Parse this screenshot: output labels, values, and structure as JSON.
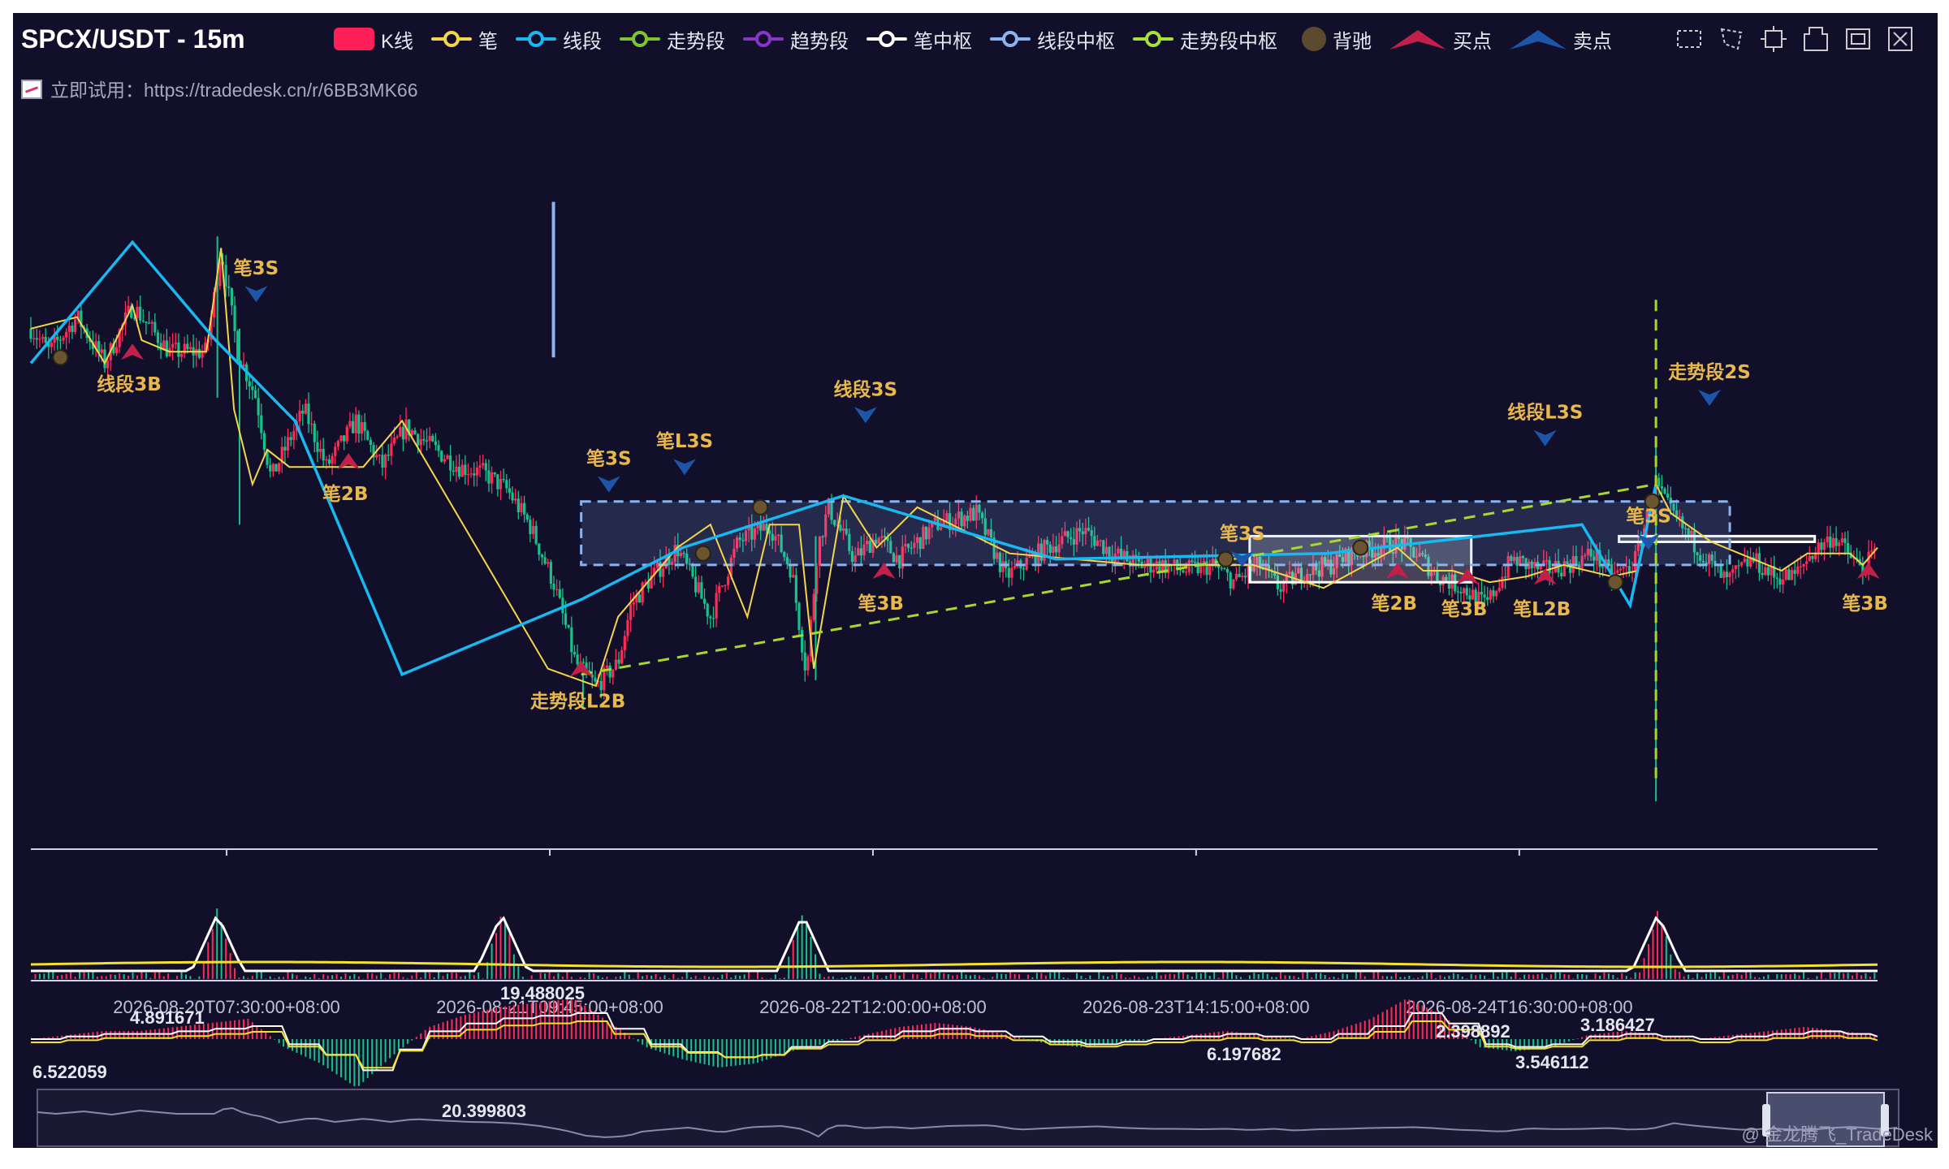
{
  "chart_header": {
    "title": "SPCX/USDT - 15m",
    "trial_text": "立即试用：https://tradedesk.cn/r/6BB3MK66"
  },
  "legend": [
    {
      "label": "K线",
      "color": "#ff1f58",
      "kind": "rect"
    },
    {
      "label": "笔",
      "color": "#f3d64a",
      "kind": "line"
    },
    {
      "label": "线段",
      "color": "#18b8f2",
      "kind": "line"
    },
    {
      "label": "走势段",
      "color": "#7cc72c",
      "kind": "line"
    },
    {
      "label": "趋势段",
      "color": "#8a34cc",
      "kind": "line"
    },
    {
      "label": "笔中枢",
      "color": "#ffffff",
      "kind": "line"
    },
    {
      "label": "线段中枢",
      "color": "#8ab4f0",
      "kind": "line"
    },
    {
      "label": "走势段中枢",
      "color": "#a6e23a",
      "kind": "line"
    },
    {
      "label": "背驰",
      "color": "#5b4a2e",
      "kind": "dot"
    },
    {
      "label": "买点",
      "color": "#c2204a",
      "kind": "up-tri"
    },
    {
      "label": "卖点",
      "color": "#1d56a8",
      "kind": "down-tri"
    }
  ],
  "toolbox_icons": [
    "rect-zoom-icon",
    "lasso-select-icon",
    "zoom-area-icon",
    "zoom-reset-icon",
    "restore-icon",
    "clear-select-icon"
  ],
  "colors": {
    "background": "#120f2b",
    "up": "#ff2a55",
    "down": "#18c08a",
    "bi": "#f3d64a",
    "xianduan": "#18b8f2",
    "zoushi": "#a6d82e",
    "pivot": "#ffffff",
    "seg_pivot": "#8ab4f0",
    "buy": "#c2204a",
    "sell": "#1d56a8",
    "divergence": "#6a5530",
    "label": "#e8b84a"
  },
  "chart_data": {
    "type": "candlestick",
    "symbol": "SPCX/USDT",
    "interval": "15m",
    "x_ticks": [
      "2026-08-20T07:30:00+08:00",
      "2026-08-21T09:45:00+08:00",
      "2026-08-22T12:00:00+08:00",
      "2026-08-23T14:15:00+08:00",
      "2026-08-24T16:30:00+08:00"
    ],
    "x_range": [
      0,
      1000
    ],
    "y_range": [
      0,
      100
    ],
    "price_path": [
      [
        0,
        72
      ],
      [
        10,
        68
      ],
      [
        25,
        74
      ],
      [
        40,
        66
      ],
      [
        55,
        76
      ],
      [
        75,
        68
      ],
      [
        95,
        68
      ],
      [
        103,
        86
      ],
      [
        112,
        68
      ],
      [
        122,
        60
      ],
      [
        130,
        46
      ],
      [
        148,
        58
      ],
      [
        160,
        48
      ],
      [
        176,
        56
      ],
      [
        190,
        48
      ],
      [
        203,
        55
      ],
      [
        215,
        52
      ],
      [
        232,
        48
      ],
      [
        245,
        47
      ],
      [
        258,
        44
      ],
      [
        270,
        38
      ],
      [
        283,
        28
      ],
      [
        295,
        14
      ],
      [
        306,
        10
      ],
      [
        318,
        14
      ],
      [
        325,
        24
      ],
      [
        334,
        28
      ],
      [
        350,
        34
      ],
      [
        368,
        22
      ],
      [
        383,
        35
      ],
      [
        400,
        38
      ],
      [
        412,
        30
      ],
      [
        420,
        12
      ],
      [
        426,
        34
      ],
      [
        432,
        41
      ],
      [
        446,
        32
      ],
      [
        458,
        36
      ],
      [
        470,
        32
      ],
      [
        490,
        38
      ],
      [
        512,
        40
      ],
      [
        528,
        29
      ],
      [
        550,
        34
      ],
      [
        570,
        37
      ],
      [
        586,
        33
      ],
      [
        600,
        31
      ],
      [
        612,
        31
      ],
      [
        626,
        30
      ],
      [
        640,
        31
      ],
      [
        652,
        28
      ],
      [
        665,
        31
      ],
      [
        676,
        27
      ],
      [
        690,
        30
      ],
      [
        704,
        31
      ],
      [
        716,
        33
      ],
      [
        730,
        34
      ],
      [
        741,
        35
      ],
      [
        750,
        33
      ],
      [
        762,
        29
      ],
      [
        775,
        27
      ],
      [
        788,
        24
      ],
      [
        802,
        32
      ],
      [
        818,
        30
      ],
      [
        832,
        31
      ],
      [
        846,
        33
      ],
      [
        856,
        29
      ],
      [
        868,
        31
      ],
      [
        880,
        45
      ],
      [
        888,
        40
      ],
      [
        900,
        35
      ],
      [
        918,
        28
      ],
      [
        932,
        32
      ],
      [
        944,
        29
      ],
      [
        955,
        29
      ],
      [
        964,
        33
      ],
      [
        976,
        36
      ],
      [
        992,
        30
      ],
      [
        1000,
        34
      ]
    ],
    "bi_points": [
      [
        0,
        72
      ],
      [
        25,
        74
      ],
      [
        40,
        66
      ],
      [
        55,
        76
      ],
      [
        60,
        70
      ],
      [
        75,
        68
      ],
      [
        95,
        68
      ],
      [
        103,
        86
      ],
      [
        110,
        58
      ],
      [
        120,
        45
      ],
      [
        128,
        51
      ],
      [
        140,
        48
      ],
      [
        160,
        48
      ],
      [
        180,
        48
      ],
      [
        201,
        56
      ],
      [
        280,
        13
      ],
      [
        306,
        10
      ],
      [
        318,
        22
      ],
      [
        334,
        28
      ],
      [
        350,
        34
      ],
      [
        368,
        38
      ],
      [
        388,
        22
      ],
      [
        400,
        38
      ],
      [
        416,
        38
      ],
      [
        424,
        13
      ],
      [
        440,
        43
      ],
      [
        458,
        34
      ],
      [
        480,
        41
      ],
      [
        530,
        33
      ],
      [
        600,
        31
      ],
      [
        662,
        31
      ],
      [
        700,
        27
      ],
      [
        740,
        34
      ],
      [
        754,
        30
      ],
      [
        770,
        30
      ],
      [
        790,
        28
      ],
      [
        810,
        29
      ],
      [
        830,
        31
      ],
      [
        856,
        29
      ],
      [
        870,
        30
      ],
      [
        880,
        45
      ],
      [
        888,
        40
      ],
      [
        910,
        35
      ],
      [
        948,
        30
      ],
      [
        962,
        33
      ],
      [
        985,
        33
      ],
      [
        992,
        31
      ],
      [
        1000,
        34
      ]
    ],
    "xianduan_points": [
      [
        0,
        66
      ],
      [
        55,
        87
      ],
      [
        100,
        70
      ],
      [
        143,
        56
      ],
      [
        201,
        12
      ],
      [
        298,
        25
      ],
      [
        353,
        34
      ],
      [
        440,
        43
      ],
      [
        555,
        32
      ],
      [
        702,
        33
      ],
      [
        840,
        38
      ],
      [
        866,
        24
      ],
      [
        880,
        45
      ]
    ],
    "zoushi_points": [
      [
        298,
        12
      ],
      [
        880,
        45
      ]
    ],
    "bi_pivots": [
      [
        110,
        62,
        200,
        70
      ],
      [
        298,
        33,
        420,
        38
      ],
      [
        440,
        28,
        640,
        41
      ],
      [
        660,
        36,
        780,
        28
      ],
      [
        860,
        36,
        966,
        35
      ]
    ],
    "seg_pivot": [
      298,
      42,
      920,
      31
    ],
    "zoushi_pivot_line": [
      298,
      12,
      880,
      45
    ],
    "divergence_points": [
      [
        16,
        67
      ],
      [
        395,
        41
      ],
      [
        364,
        33
      ],
      [
        647,
        32
      ],
      [
        858,
        28
      ],
      [
        720,
        34
      ],
      [
        878,
        42
      ]
    ],
    "buy_points": [
      {
        "x": 55,
        "y": 68,
        "label": "线段3B"
      },
      {
        "x": 172,
        "y": 49,
        "label": "笔2B"
      },
      {
        "x": 298,
        "y": 13,
        "label": "走势段L2B"
      },
      {
        "x": 462,
        "y": 30,
        "label": "笔3B"
      },
      {
        "x": 740,
        "y": 30,
        "label": "笔2B"
      },
      {
        "x": 778,
        "y": 29,
        "label": "笔3B"
      },
      {
        "x": 820,
        "y": 29,
        "label": "笔L2B"
      },
      {
        "x": 995,
        "y": 30,
        "label": "笔3B"
      }
    ],
    "sell_points": [
      {
        "x": 122,
        "y": 78,
        "label": "笔3S"
      },
      {
        "x": 313,
        "y": 45,
        "label": "笔3S"
      },
      {
        "x": 354,
        "y": 48,
        "label": "笔L3S"
      },
      {
        "x": 452,
        "y": 57,
        "label": "线段3S"
      },
      {
        "x": 656,
        "y": 32,
        "label": "笔3S"
      },
      {
        "x": 820,
        "y": 53,
        "label": "线段L3S"
      },
      {
        "x": 876,
        "y": 35,
        "label": "笔3S"
      },
      {
        "x": 909,
        "y": 60,
        "label": "走势段2S"
      }
    ],
    "volume_annotations": [
      "19.488025",
      "4.891671",
      "6.522059",
      "20.399803",
      "6.197682",
      "2.398892",
      "3.546112",
      "3.186427"
    ],
    "macd_hist_sample": [
      0,
      1,
      2,
      2,
      3,
      4,
      5,
      -2,
      -6,
      -12,
      -4,
      3,
      6,
      8,
      9,
      10,
      4,
      -2,
      -5,
      -7,
      -6,
      -3,
      -1,
      1,
      3,
      4,
      3,
      1,
      -1,
      -2,
      -1,
      0,
      1,
      2,
      1,
      0,
      2,
      5,
      10,
      6,
      -2,
      -3,
      -2,
      1,
      2,
      1,
      0,
      1,
      2,
      3,
      2,
      1
    ]
  },
  "watermark": "@ 金龙腾飞_TradeDesk"
}
